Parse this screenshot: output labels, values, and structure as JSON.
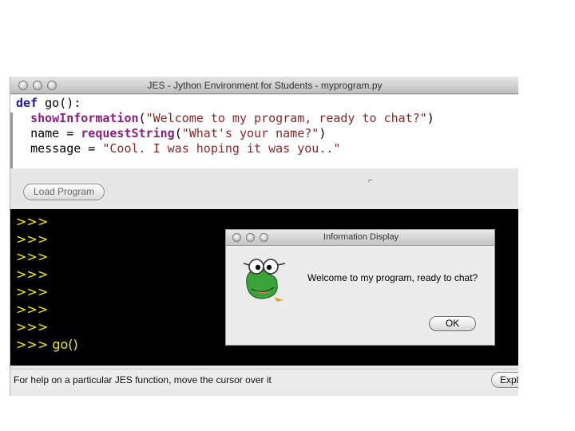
{
  "window": {
    "title": "JES - Jython Environment for Students - myprogram.py"
  },
  "editor": {
    "lines": [
      {
        "kw": "def",
        "plain": " go():"
      },
      {
        "indent": "  ",
        "fn": "showInformation",
        "open": "(",
        "str": "\"Welcome to my program, ready to chat?\"",
        "close": ")"
      },
      {
        "indent": "  ",
        "plain": "name = ",
        "fn": "requestString",
        "open": "(",
        "str": "\"What's your name?\"",
        "close": ")"
      },
      {
        "indent": "  ",
        "plain": "message = ",
        "str": "\"Cool. I was hoping it was you..\""
      }
    ]
  },
  "toolbar": {
    "load_label": "Load Program"
  },
  "console": {
    "prompts": [
      ">>>",
      ">>>",
      ">>>",
      ">>>",
      ">>>",
      ">>>",
      ">>>"
    ],
    "last_prompt": ">>>",
    "last_command": "go()"
  },
  "dialog": {
    "title": "Information Display",
    "message": "Welcome to my program, ready to chat?",
    "ok_label": "OK"
  },
  "status": {
    "help_text": "For help on a particular JES function, move the cursor over it",
    "explain_label": "Expl"
  },
  "colors": {
    "keyword": "#1d1ba8",
    "function": "#8b1f7d",
    "string": "#8b2727",
    "prompt": "#f4f000",
    "console_bg": "#000000"
  }
}
